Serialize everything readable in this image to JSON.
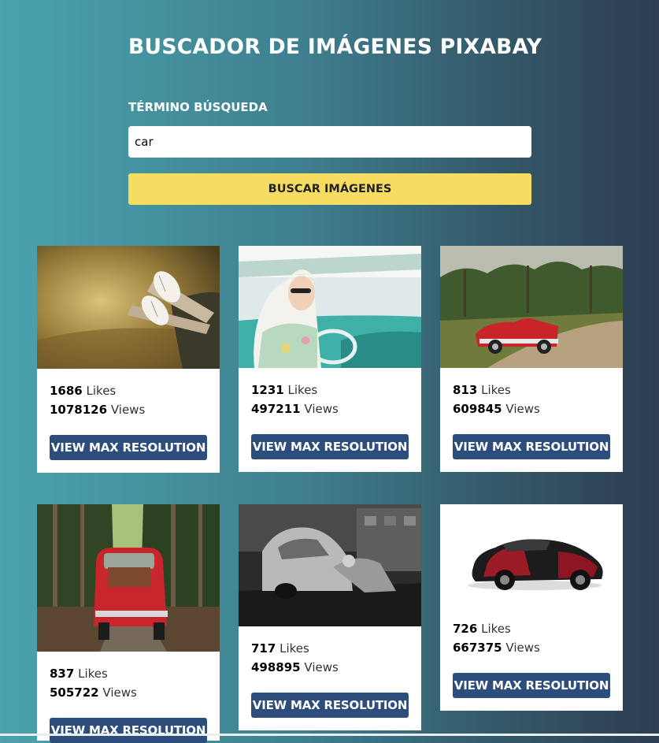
{
  "header": {
    "title": "BUSCADOR DE IMÁGENES PIXABAY",
    "search_label": "TÉRMINO BÚSQUEDA",
    "search_value": "car",
    "search_placeholder": "",
    "button_label": "BUSCAR IMÁGENES"
  },
  "colors": {
    "gradient_start": "#4aa3ad",
    "gradient_end": "#2c3e50",
    "search_button": "#f6dc60",
    "card_button": "#2d4e7c"
  },
  "results": [
    {
      "image": "legs-sneakers-out-of-car-window",
      "likes": "1686",
      "likes_label": "Likes",
      "views": "1078126",
      "views_label": "Views",
      "button": "VIEW MAX RESOLUTION"
    },
    {
      "image": "woman-with-headscarf-driving-classic-car",
      "likes": "1231",
      "likes_label": "Likes",
      "views": "497211",
      "views_label": "Views",
      "button": "VIEW MAX RESOLUTION"
    },
    {
      "image": "red-vintage-convertible-on-road",
      "likes": "813",
      "likes_label": "Likes",
      "views": "609845",
      "views_label": "Views",
      "button": "VIEW MAX RESOLUTION"
    },
    {
      "image": "red-fiat-500-in-tree-alley",
      "likes": "837",
      "likes_label": "Likes",
      "views": "505722",
      "views_label": "Views",
      "button": "VIEW MAX RESOLUTION"
    },
    {
      "image": "black-and-white-old-car-with-person",
      "likes": "717",
      "likes_label": "Likes",
      "views": "498895",
      "views_label": "Views",
      "button": "VIEW MAX RESOLUTION"
    },
    {
      "image": "red-black-bugatti-veyron",
      "likes": "726",
      "likes_label": "Likes",
      "views": "667375",
      "views_label": "Views",
      "button": "VIEW MAX RESOLUTION"
    }
  ]
}
